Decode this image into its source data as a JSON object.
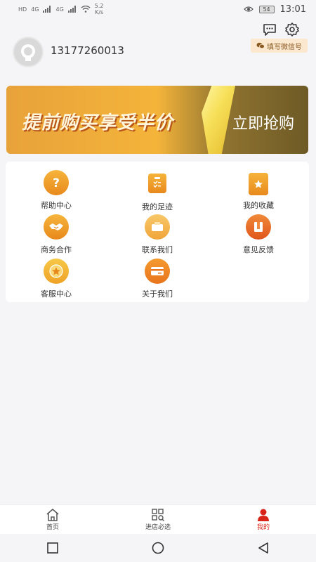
{
  "status_bar": {
    "signal_left_1": "HD",
    "signal_left_2": "4G",
    "signal_left_3": "4G",
    "net_speed_value": "5.2",
    "net_speed_unit": "K/s",
    "battery": "54",
    "time": "13:01"
  },
  "header": {
    "phone": "13177260013",
    "wechat_label": "填写微信号"
  },
  "banner": {
    "title": "提前购买享受半价",
    "cta": "立即抢购"
  },
  "menu": {
    "items": [
      {
        "label": "帮助中心",
        "icon": "question-icon"
      },
      {
        "label": "我的足迹",
        "icon": "clipboard-icon"
      },
      {
        "label": "我的收藏",
        "icon": "bag-star-icon"
      },
      {
        "label": "商务合作",
        "icon": "handshake-icon"
      },
      {
        "label": "联系我们",
        "icon": "wallet-icon"
      },
      {
        "label": "意见反馈",
        "icon": "feedback-icon"
      },
      {
        "label": "客服中心",
        "icon": "star-badge-icon"
      },
      {
        "label": "关于我们",
        "icon": "card-icon"
      }
    ]
  },
  "bottom_nav": {
    "home": "首页",
    "shop": "进店必选",
    "mine": "我的"
  },
  "colors": {
    "accent_red": "#d9241a",
    "icon_orange": "#ef9a24"
  }
}
